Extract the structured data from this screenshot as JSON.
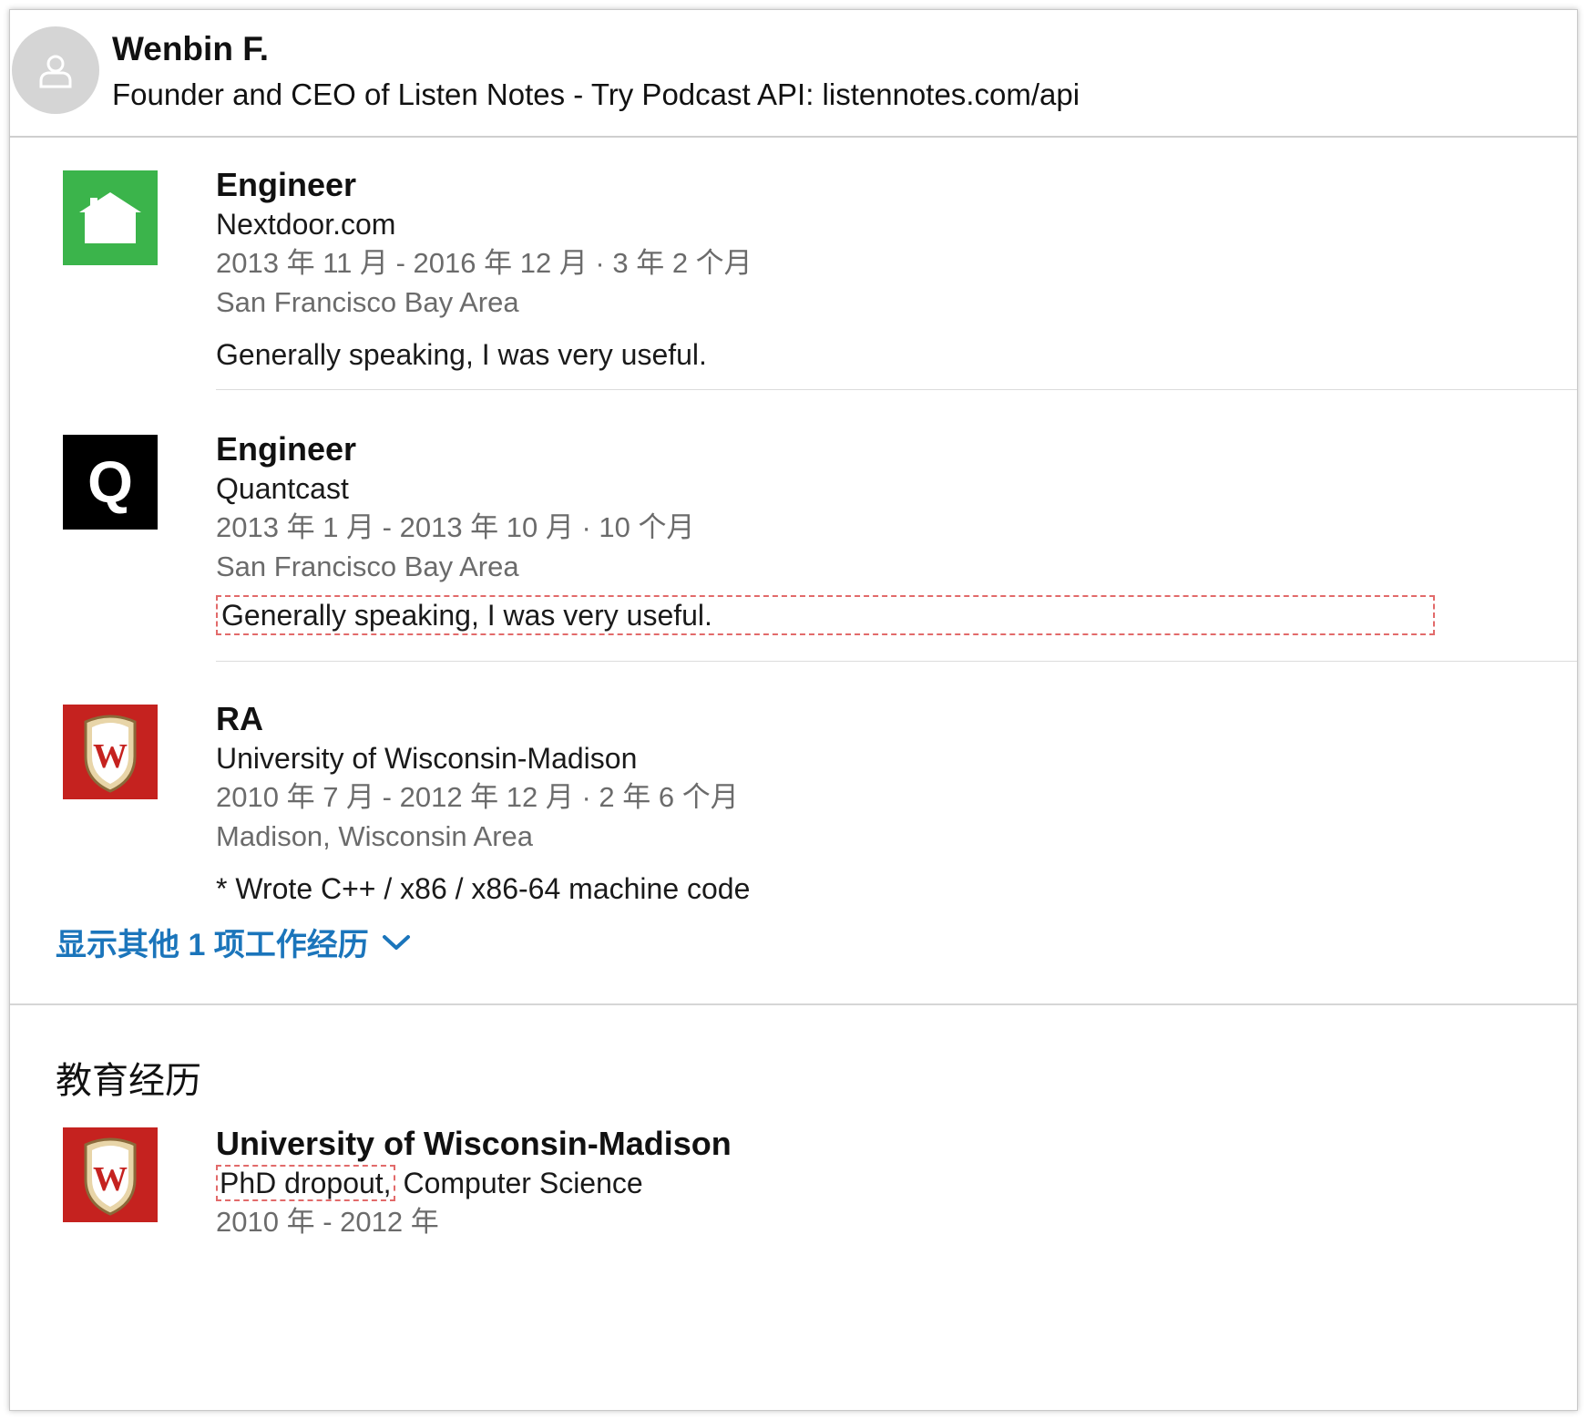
{
  "profile": {
    "name": "Wenbin F.",
    "headline": "Founder and CEO of Listen Notes - Try Podcast API: listennotes.com/api",
    "avatar_icon": "user-silhouette-icon"
  },
  "experience": [
    {
      "title": "Engineer",
      "company": "Nextdoor.com",
      "dates": "2013 年 11 月 - 2016 年 12 月 · 3 年 2 个月",
      "location": "San Francisco Bay Area",
      "description": "Generally speaking, I was very useful.",
      "logo_icon": "nextdoor-house-logo",
      "logo_color": "#3bb44b"
    },
    {
      "title": "Engineer",
      "company": "Quantcast",
      "dates": "2013 年 1 月 - 2013 年 10 月 · 10 个月",
      "location": "San Francisco Bay Area",
      "description": "Generally speaking, I was very useful.",
      "logo_icon": "quantcast-q-logo",
      "logo_color": "#000000",
      "logo_letter": "Q"
    },
    {
      "title": "RA",
      "company": "University of Wisconsin-Madison",
      "dates": "2010 年 7 月 - 2012 年 12 月 · 2 年 6 个月",
      "location": "Madison, Wisconsin Area",
      "description": "* Wrote C++ / x86 / x86-64 machine code",
      "logo_icon": "uw-crest-logo",
      "logo_color": "#c5221f",
      "logo_letter": "W"
    }
  ],
  "show_more": {
    "label": "显示其他 1 项工作经历",
    "icon": "chevron-down-icon",
    "color": "#1b75bb"
  },
  "education": {
    "section_title": "教育经历",
    "items": [
      {
        "school": "University of Wisconsin-Madison",
        "degree": "PhD dropout,",
        "field": " Computer Science",
        "dates": "2010 年 - 2012 年",
        "logo_icon": "uw-crest-logo",
        "logo_letter": "W"
      }
    ]
  },
  "highlight_color": "#e26a6a"
}
